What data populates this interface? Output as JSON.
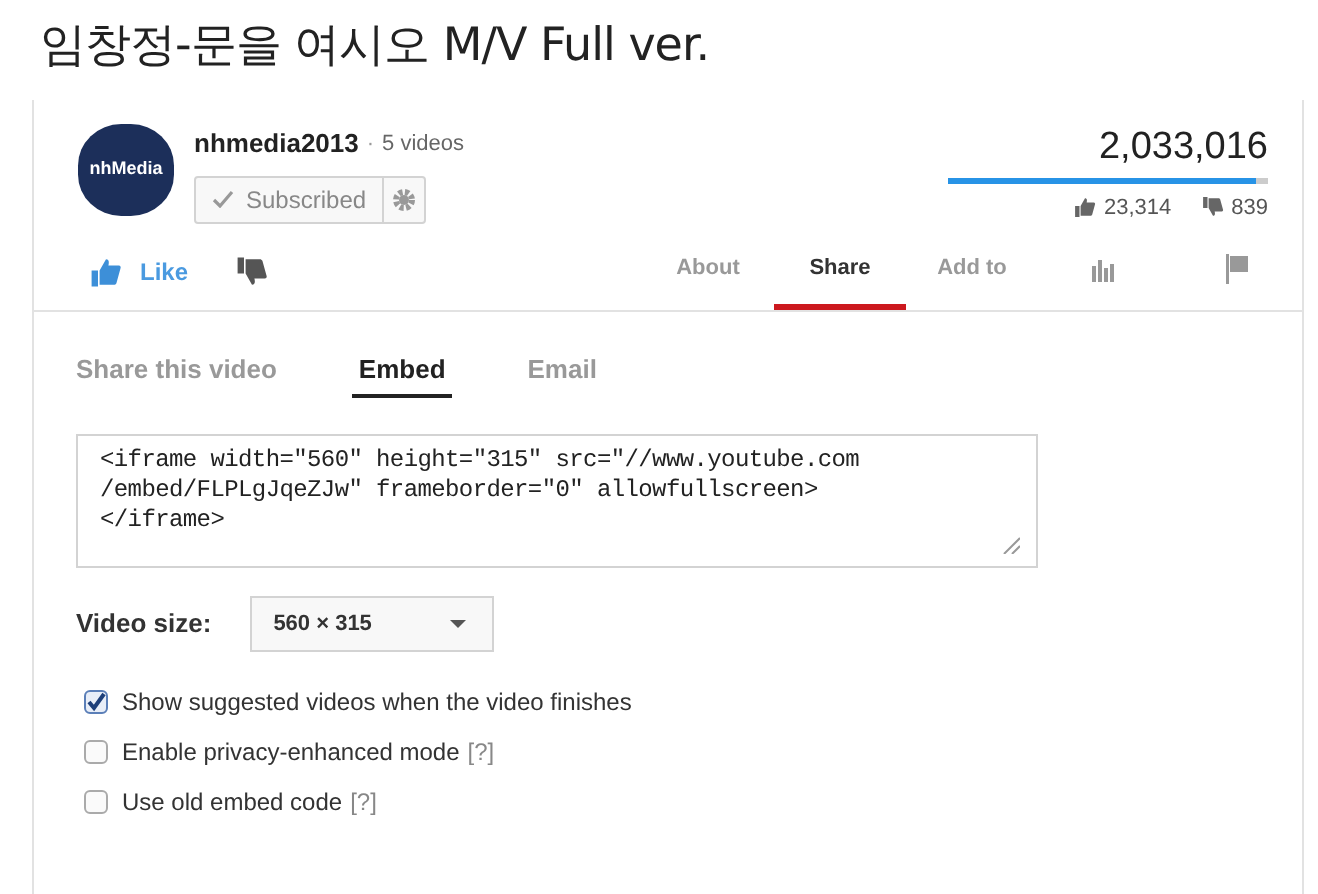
{
  "title": "임창정-문을 여시오 M/V Full ver.",
  "channel": {
    "name": "nhmedia2013",
    "separator": "·",
    "video_count": "5 videos",
    "subscribe_label": "Subscribed",
    "logo_text": "nhMedia"
  },
  "stats": {
    "views": "2,033,016",
    "level": 0.965,
    "likes": "23,314",
    "dislikes": "839"
  },
  "like_label": "Like",
  "tabs": [
    {
      "kind": "text",
      "label": "About",
      "selected": false
    },
    {
      "kind": "text",
      "label": "Share",
      "selected": true
    },
    {
      "kind": "text",
      "label": "Add to",
      "selected": false
    },
    {
      "kind": "stats",
      "selected": false
    },
    {
      "kind": "flag",
      "selected": false
    }
  ],
  "share_tabs": [
    {
      "label": "Share this video",
      "selected": false
    },
    {
      "label": "Embed",
      "selected": true
    },
    {
      "label": "Email",
      "selected": false
    }
  ],
  "embed_code": [
    "<iframe width=\"560\" height=\"315\" src=\"//www.youtube.com",
    "/embed/FLPLgJqeZJw\" frameborder=\"0\" allowfullscreen>",
    "</iframe>"
  ],
  "video_size": {
    "label": "Video size:",
    "value": "560 × 315"
  },
  "options": [
    {
      "label": "Show suggested videos when the video finishes",
      "checked": true
    },
    {
      "label": "Enable privacy-enhanced mode",
      "checked": false,
      "help": "[?]"
    },
    {
      "label": "Use old embed code",
      "checked": false,
      "help": "[?]"
    }
  ]
}
